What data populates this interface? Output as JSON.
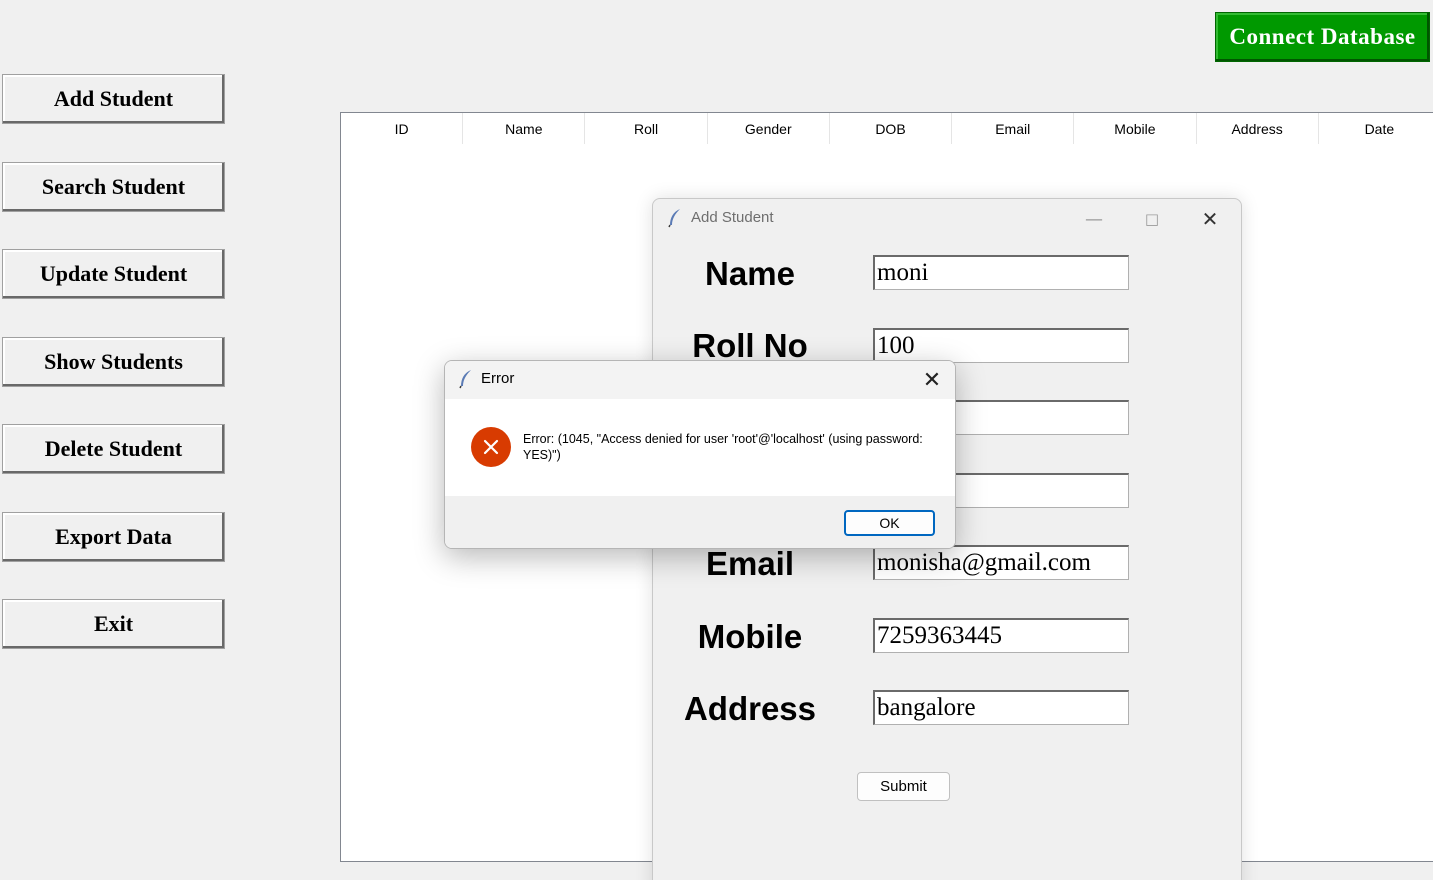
{
  "header": {
    "connect_label": "Connect Database",
    "connect_color": "#009900"
  },
  "sidebar": {
    "items": [
      {
        "label": "Add Student"
      },
      {
        "label": "Search Student"
      },
      {
        "label": "Update Student"
      },
      {
        "label": "Show Students"
      },
      {
        "label": "Delete Student"
      },
      {
        "label": "Export Data"
      },
      {
        "label": "Exit"
      }
    ]
  },
  "table": {
    "columns": [
      "ID",
      "Name",
      "Roll",
      "Gender",
      "DOB",
      "Email",
      "Mobile",
      "Address",
      "Date"
    ]
  },
  "add_window": {
    "title": "Add Student",
    "icon": "feather-icon",
    "controls": {
      "minimize": "—",
      "maximize": "□",
      "close": "✕"
    },
    "fields": [
      {
        "label": "Name",
        "value": "moni"
      },
      {
        "label": "Roll No",
        "value": "100"
      },
      {
        "label": "",
        "value": ""
      },
      {
        "label": "",
        "value": ""
      },
      {
        "label": "Email",
        "value": "monisha@gmail.com"
      },
      {
        "label": "Mobile",
        "value": "7259363445"
      },
      {
        "label": "Address",
        "value": "bangalore"
      }
    ],
    "submit_label": "Submit"
  },
  "error_dialog": {
    "title": "Error",
    "icon": "error-icon",
    "icon_color": "#d83b01",
    "message": "Error: (1045, \"Access denied for user 'root'@'localhost' (using password: YES)\")",
    "ok_label": "OK",
    "close_glyph": "✕"
  }
}
